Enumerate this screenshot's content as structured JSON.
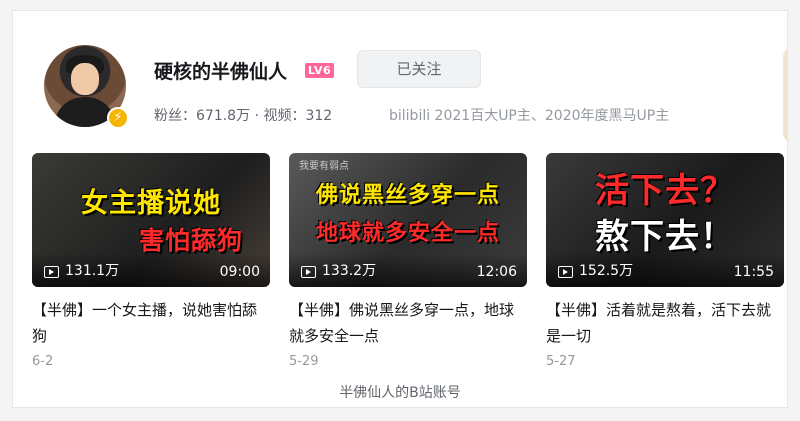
{
  "profile": {
    "username": "硬核的半佛仙人",
    "level": "LV6",
    "follow_label": "已关注",
    "fans_label": "粉丝：",
    "fans_count": "671.8万",
    "separator": "·",
    "videos_label": "视频：",
    "videos_count": "312",
    "bio": "bilibili 2021百大UP主、2020年度黑马UP主"
  },
  "videos": [
    {
      "thumb_lines": [
        "女主播说她",
        "害怕舔狗"
      ],
      "thumb_small": "",
      "views": "131.1万",
      "duration": "09:00",
      "title": "【半佛】一个女主播，说她害怕舔狗",
      "date": "6-2"
    },
    {
      "thumb_lines": [
        "佛说黑丝多穿一点",
        "地球就多安全一点"
      ],
      "thumb_small": "我要有弱点",
      "views": "133.2万",
      "duration": "12:06",
      "title": "【半佛】佛说黑丝多穿一点，地球就多安全一点",
      "date": "5-29"
    },
    {
      "thumb_lines": [
        "活下去？",
        "熬下去！"
      ],
      "thumb_small": "",
      "views": "152.5万",
      "duration": "11:55",
      "title": "【半佛】活着就是熬着，活下去就是一切",
      "date": "5-27"
    }
  ],
  "caption": "半佛仙人的B站账号",
  "colors": {
    "accent_pink": "#ff6699",
    "verify_yellow": "#f5b400",
    "thumb_yellow": "#ffe600",
    "thumb_red": "#ff2a2a"
  }
}
